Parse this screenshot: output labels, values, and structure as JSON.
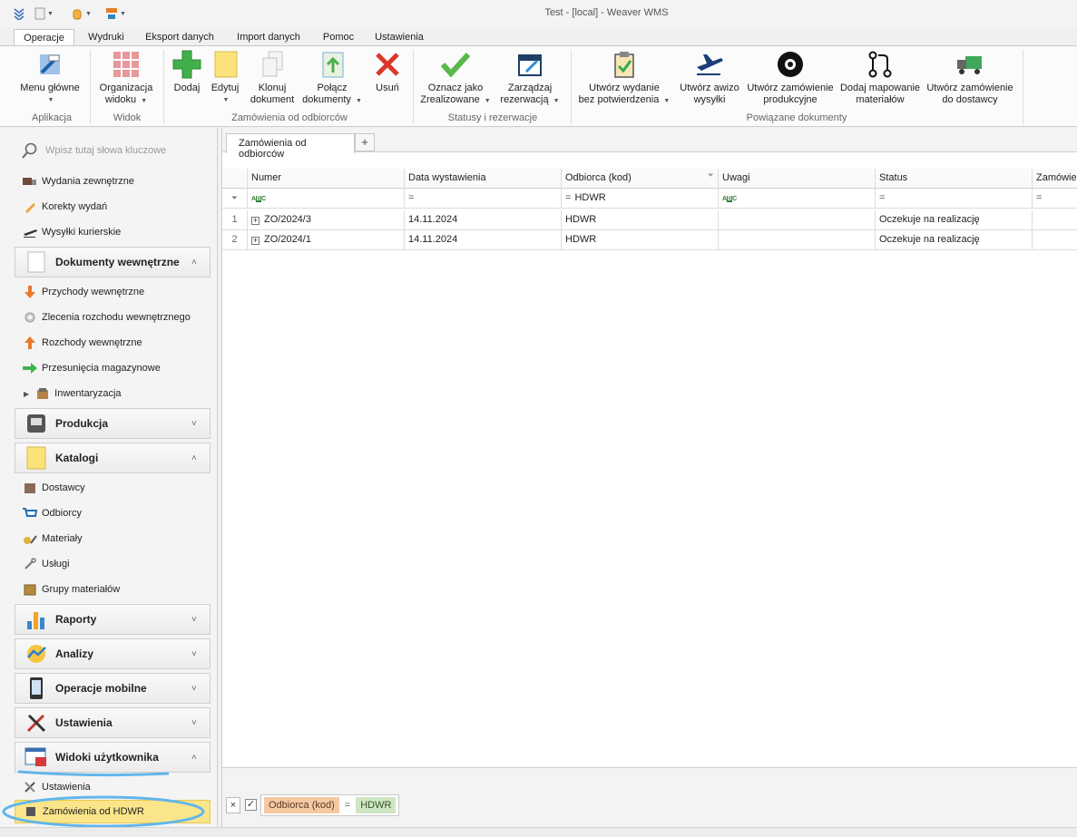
{
  "window": {
    "title": "Test - [local] - Weaver WMS"
  },
  "quick_access": [
    "app-menu-icon",
    "document-icon",
    "hand-icon",
    "abc-icon"
  ],
  "ribbon_tabs": [
    "Operacje",
    "Wydruki",
    "Eksport danych",
    "Import danych",
    "Pomoc",
    "Ustawienia"
  ],
  "ribbon": {
    "menu_glowne": "Menu główne",
    "organizacja_l1": "Organizacja",
    "organizacja_l2": "widoku",
    "dodaj": "Dodaj",
    "edytuj": "Edytuj",
    "klonuj_l1": "Klonuj",
    "klonuj_l2": "dokument",
    "polacz_l1": "Połącz",
    "polacz_l2": "dokumenty",
    "usun": "Usuń",
    "oznacz_l1": "Oznacz jako",
    "oznacz_l2": "Zrealizowane",
    "zarzadzaj_l1": "Zarządzaj",
    "zarzadzaj_l2": "rezerwacją",
    "wydanie_l1": "Utwórz wydanie",
    "wydanie_l2": "bez potwierdzenia",
    "awizo_l1": "Utwórz awizo",
    "awizo_l2": "wysyłki",
    "produkcyjne_l1": "Utwórz zamówienie",
    "produkcyjne_l2": "produkcyjne",
    "mapowanie_l1": "Dodaj mapowanie",
    "mapowanie_l2": "materiałów",
    "dostawcy_l1": "Utwórz zamówienie",
    "dostawcy_l2": "do dostawcy",
    "groups": {
      "aplikacja": "Aplikacja",
      "widok": "Widok",
      "zamowienia": "Zamówienia od odbiorców",
      "statusy": "Statusy i rezerwacje",
      "powiazane": "Powiązane dokumenty"
    }
  },
  "nav": {
    "search_placeholder": "Wpisz tutaj słowa kluczowe",
    "items_top": [
      "Wydania zewnętrzne",
      "Korekty wydań",
      "Wysyłki kurierskie"
    ],
    "group_dokumenty": "Dokumenty wewnętrzne",
    "items_dokumenty": [
      "Przychody wewnętrzne",
      "Zlecenia rozchodu wewnętrznego",
      "Rozchody wewnętrzne",
      "Przesunięcia magazynowe",
      "Inwentaryzacja"
    ],
    "group_produkcja": "Produkcja",
    "group_katalogi": "Katalogi",
    "items_katalogi": [
      "Dostawcy",
      "Odbiorcy",
      "Materiały",
      "Usługi",
      "Grupy materiałów"
    ],
    "group_raporty": "Raporty",
    "group_analizy": "Analizy",
    "group_mobilne": "Operacje mobilne",
    "group_ustawienia": "Ustawienia",
    "group_widoki": "Widoki użytkownika",
    "items_widoki": [
      "Ustawienia",
      "Zamówienia od HDWR"
    ]
  },
  "doc": {
    "tab": "Zamówienia od odbiorców",
    "tab_add": "+",
    "columns": [
      "Numer",
      "Data wystawienia",
      "Odbiorca (kod)",
      "Uwagi",
      "Status",
      "Zamówien"
    ],
    "filter_row": {
      "numer": "",
      "data": "=",
      "odbiorca_op": "=",
      "odbiorca_val": "HDWR",
      "uwagi": "",
      "status": "=",
      "zam": "="
    },
    "rows": [
      {
        "n": "1",
        "numer": "ZO/2024/3",
        "data": "14.11.2024",
        "odbiorca": "HDWR",
        "uwagi": "",
        "status": "Oczekuje na realizację"
      },
      {
        "n": "2",
        "numer": "ZO/2024/1",
        "data": "14.11.2024",
        "odbiorca": "HDWR",
        "uwagi": "",
        "status": "Oczekuje na realizację"
      }
    ],
    "filter_panel": {
      "field": "Odbiorca (kod)",
      "op": "=",
      "value": "HDWR"
    }
  }
}
